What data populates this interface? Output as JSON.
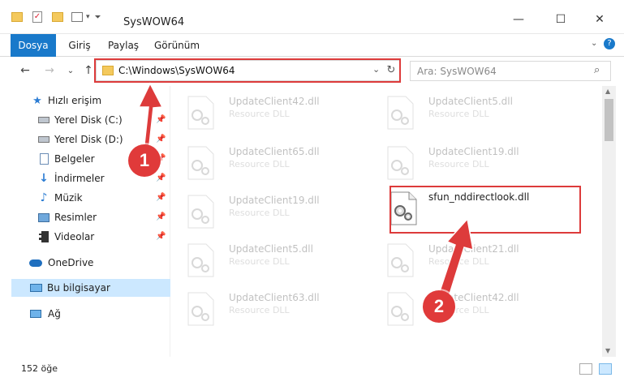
{
  "window": {
    "title": "SysWOW64",
    "minimize": "—",
    "maximize": "☐",
    "close": "✕"
  },
  "ribbon": {
    "tabs": [
      "Dosya",
      "Giriş",
      "Paylaş",
      "Görünüm"
    ]
  },
  "address": {
    "path": "C:\\Windows\\SysWOW64",
    "search_placeholder": "Ara: SysWOW64"
  },
  "sidebar": {
    "items": [
      {
        "label": "Hızlı erişim",
        "icon": "star-icon"
      },
      {
        "label": "Yerel Disk (C:)",
        "icon": "drive-icon",
        "pinned": true
      },
      {
        "label": "Yerel Disk (D:)",
        "icon": "drive-icon",
        "pinned": true
      },
      {
        "label": "Belgeler",
        "icon": "documents-icon",
        "pinned": true
      },
      {
        "label": "İndirmeler",
        "icon": "download-icon",
        "pinned": true
      },
      {
        "label": "Müzik",
        "icon": "music-icon",
        "pinned": true
      },
      {
        "label": "Resimler",
        "icon": "pictures-icon",
        "pinned": true
      },
      {
        "label": "Videolar",
        "icon": "videos-icon",
        "pinned": true
      },
      {
        "label": "OneDrive",
        "icon": "cloud-icon"
      },
      {
        "label": "Bu bilgisayar",
        "icon": "computer-icon",
        "selected": true
      },
      {
        "label": "Ağ",
        "icon": "network-icon"
      }
    ]
  },
  "files": [
    {
      "name": "UpdateClient42.dll",
      "type": "Resource DLL"
    },
    {
      "name": "UpdateClient5.dll",
      "type": "Resource DLL"
    },
    {
      "name": "UpdateClient65.dll",
      "type": "Resource DLL"
    },
    {
      "name": "UpdateClient19.dll",
      "type": "Resource DLL"
    },
    {
      "name": "UpdateClient19.dll",
      "type": "Resource DLL"
    },
    {
      "name": "sfun_nddirectlook.dll",
      "type": ""
    },
    {
      "name": "UpdateClient5.dll",
      "type": "Resource DLL"
    },
    {
      "name": "UpdateClient21.dll",
      "type": "Resource DLL"
    },
    {
      "name": "UpdateClient63.dll",
      "type": "Resource DLL"
    },
    {
      "name": "UpdateClient42.dll",
      "type": "Resource DLL"
    }
  ],
  "status": {
    "count": "152 öğe"
  },
  "annotations": {
    "badge1": "1",
    "badge2": "2",
    "color": "#dd3b3b"
  },
  "colors": {
    "accent": "#1979ca",
    "selected_bg": "#cce8ff"
  }
}
